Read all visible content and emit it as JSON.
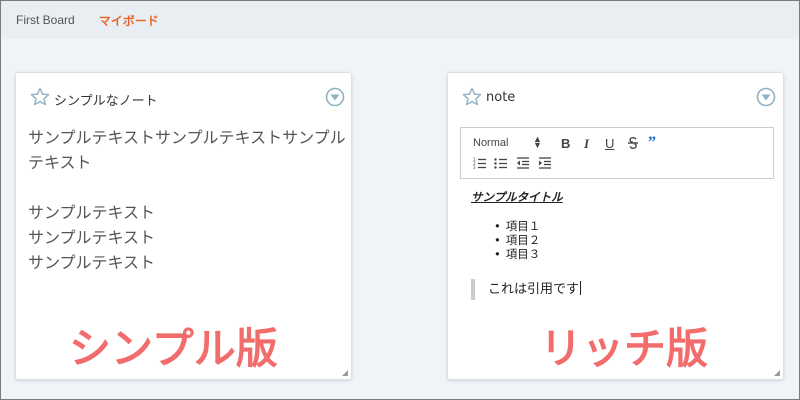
{
  "tabs": [
    {
      "label": "First Board"
    },
    {
      "label": "マイボード"
    }
  ],
  "cards": {
    "simple": {
      "title": "シンプルなノート",
      "lines": [
        "サンプルテキストサンプルテキストサンプル",
        "テキスト",
        "",
        "サンプルテキスト",
        "サンプルテキスト",
        "サンプルテキスト"
      ]
    },
    "rich": {
      "title": "note",
      "toolbar": {
        "font_select": "Normal",
        "bold": "B",
        "italic": "I",
        "underline": "U",
        "strike": "S",
        "quote": "”"
      },
      "content_title": "サンプルタイトル",
      "list_items": [
        "項目１",
        "項目２",
        "項目３"
      ],
      "quote": "これは引用です"
    }
  },
  "overlays": {
    "simple": "シンプル版",
    "rich": "リッチ版"
  },
  "colors": {
    "accent": "#e8662b",
    "overlay_text": "#f26c6c",
    "icon": "#8fb3c3",
    "quote_icon": "#1e64c8"
  }
}
